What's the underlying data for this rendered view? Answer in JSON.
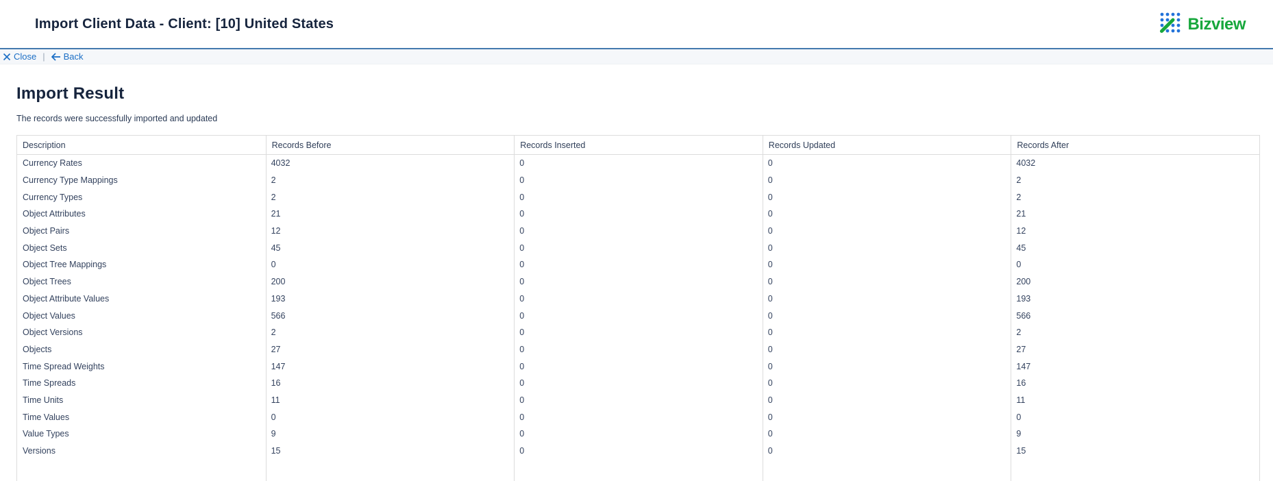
{
  "header": {
    "title": "Import Client Data - Client: [10] United States",
    "logo_text": "Bizview"
  },
  "toolbar": {
    "close_label": "Close",
    "divider": "|",
    "back_label": "Back"
  },
  "main": {
    "heading": "Import Result",
    "subtitle": "The records were successfully imported and updated"
  },
  "table": {
    "columns": [
      "Description",
      "Records Before",
      "Records Inserted",
      "Records Updated",
      "Records After"
    ],
    "rows": [
      {
        "description": "Currency Rates",
        "before": "4032",
        "inserted": "0",
        "updated": "0",
        "after": "4032"
      },
      {
        "description": "Currency Type Mappings",
        "before": "2",
        "inserted": "0",
        "updated": "0",
        "after": "2"
      },
      {
        "description": "Currency Types",
        "before": "2",
        "inserted": "0",
        "updated": "0",
        "after": "2"
      },
      {
        "description": "Object Attributes",
        "before": "21",
        "inserted": "0",
        "updated": "0",
        "after": "21"
      },
      {
        "description": "Object Pairs",
        "before": "12",
        "inserted": "0",
        "updated": "0",
        "after": "12"
      },
      {
        "description": "Object Sets",
        "before": "45",
        "inserted": "0",
        "updated": "0",
        "after": "45"
      },
      {
        "description": "Object Tree Mappings",
        "before": "0",
        "inserted": "0",
        "updated": "0",
        "after": "0"
      },
      {
        "description": "Object Trees",
        "before": "200",
        "inserted": "0",
        "updated": "0",
        "after": "200"
      },
      {
        "description": "Object Attribute Values",
        "before": "193",
        "inserted": "0",
        "updated": "0",
        "after": "193"
      },
      {
        "description": "Object Values",
        "before": "566",
        "inserted": "0",
        "updated": "0",
        "after": "566"
      },
      {
        "description": "Object Versions",
        "before": "2",
        "inserted": "0",
        "updated": "0",
        "after": "2"
      },
      {
        "description": "Objects",
        "before": "27",
        "inserted": "0",
        "updated": "0",
        "after": "27"
      },
      {
        "description": "Time Spread Weights",
        "before": "147",
        "inserted": "0",
        "updated": "0",
        "after": "147"
      },
      {
        "description": "Time Spreads",
        "before": "16",
        "inserted": "0",
        "updated": "0",
        "after": "16"
      },
      {
        "description": "Time Units",
        "before": "11",
        "inserted": "0",
        "updated": "0",
        "after": "11"
      },
      {
        "description": "Time Values",
        "before": "0",
        "inserted": "0",
        "updated": "0",
        "after": "0"
      },
      {
        "description": "Value Types",
        "before": "9",
        "inserted": "0",
        "updated": "0",
        "after": "9"
      },
      {
        "description": "Versions",
        "before": "15",
        "inserted": "0",
        "updated": "0",
        "after": "15"
      }
    ]
  },
  "colors": {
    "accent_blue_line": "#4379ae",
    "link_blue": "#1c6fc6",
    "logo_green": "#17a73c",
    "logo_dot_blue": "#2272d9",
    "text_dark": "#16243d",
    "table_border": "#dcdcdc",
    "toolbar_bg": "#f5f7fa"
  }
}
